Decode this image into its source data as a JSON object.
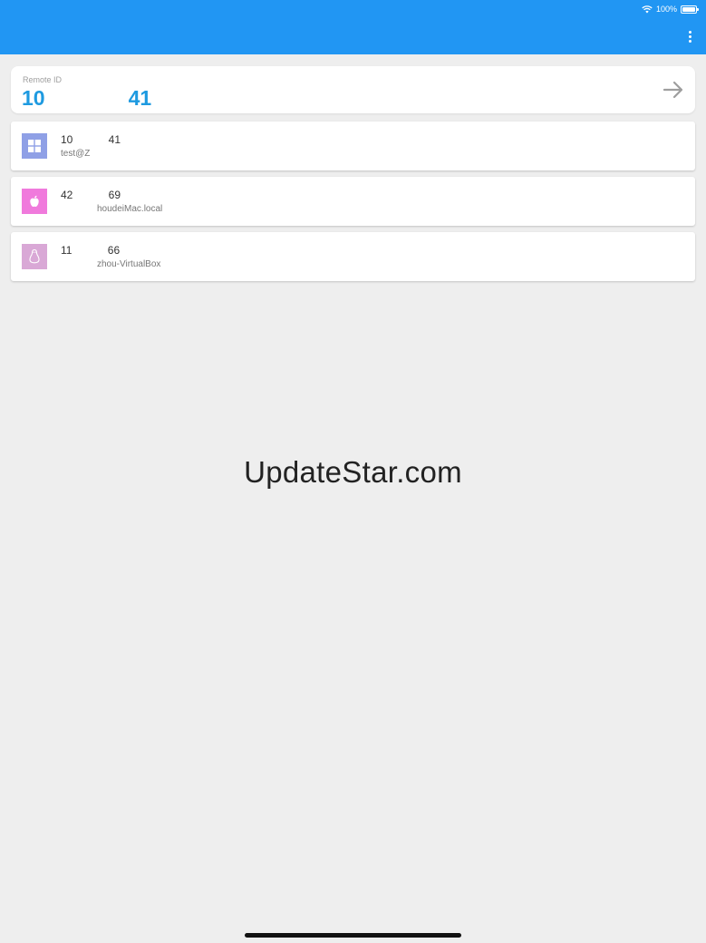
{
  "status_bar": {
    "battery_text": "100%",
    "wifi_icon": "wifi-icon",
    "battery_icon": "battery-icon"
  },
  "app_bar": {
    "color": "#2196f3",
    "menu_icon": "more-vert-icon"
  },
  "remote": {
    "label": "Remote ID",
    "value": "10    41",
    "go_icon": "arrow-right-icon"
  },
  "peers": [
    {
      "id": "10    41",
      "name": "test@Z",
      "platform": "windows",
      "icon": "windows-icon",
      "color": "#8fa0e6"
    },
    {
      "id": "42    69",
      "name": "    houdeiMac.local",
      "platform": "mac",
      "icon": "apple-icon",
      "color": "#f07adc"
    },
    {
      "id": "11    66",
      "name": "    zhou-VirtualBox",
      "platform": "linux",
      "icon": "linux-icon",
      "color": "#d9a8d6"
    }
  ],
  "watermark": "UpdateStar.com"
}
